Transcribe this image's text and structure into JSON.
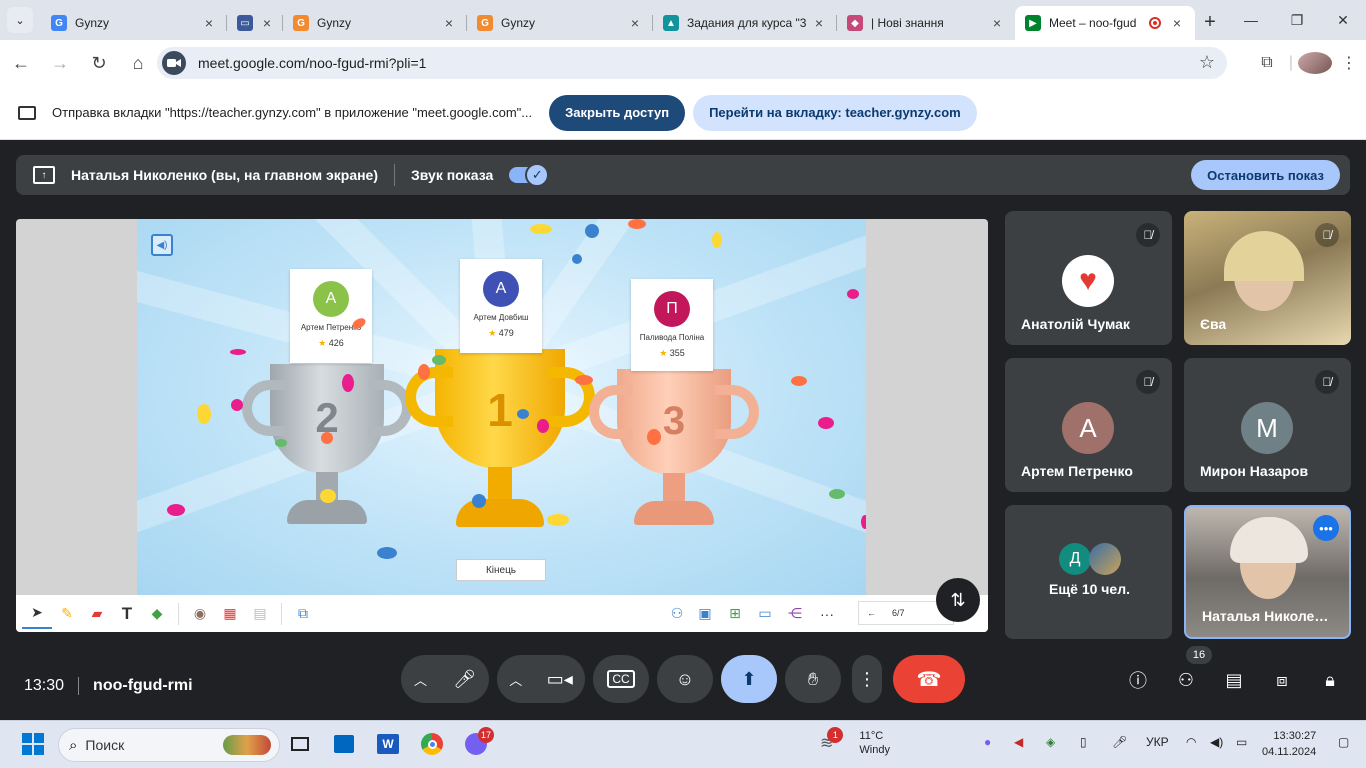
{
  "browser": {
    "tabs": [
      {
        "title": "Gynzy",
        "fav": "G",
        "color": "#4285f4"
      },
      {
        "title": "",
        "fav": "▭",
        "color": "#3c5a9a"
      },
      {
        "title": "Gynzy",
        "fav": "G",
        "color": "#f28b30"
      },
      {
        "title": "Gynzy",
        "fav": "G",
        "color": "#f28b30"
      },
      {
        "title": "Задания для курса \"3",
        "fav": "▲",
        "color": "#12949c"
      },
      {
        "title": "| Нові знання",
        "fav": "◆",
        "color": "#c44a7a"
      },
      {
        "title": "Meet – noo-fgud",
        "fav": "▶",
        "color": "#00832d"
      }
    ],
    "url": "meet.google.com/noo-fgud-rmi?pli=1"
  },
  "sharebar": {
    "message": "Отправка вкладки \"https://teacher.gynzy.com\" в приложение \"meet.google.com\"...",
    "stop_access": "Закрыть доступ",
    "goto_tab": "Перейти на вкладку: teacher.gynzy.com"
  },
  "presenting": {
    "name": "Наталья Николенко (вы, на главном экране)",
    "sound_label": "Звук показа",
    "stop_button": "Остановить показ"
  },
  "podium": [
    {
      "place": "2",
      "initial": "A",
      "name": "Артем Петренко",
      "score": "426",
      "color": "#8bc34a"
    },
    {
      "place": "1",
      "initial": "A",
      "name": "Артем Довбиш",
      "score": "479",
      "color": "#3f51b5"
    },
    {
      "place": "3",
      "initial": "П",
      "name": "Паливода Поліна",
      "score": "355",
      "color": "#c2185b"
    }
  ],
  "game": {
    "end_button": "Кінець",
    "pager": "6/7"
  },
  "participants": [
    {
      "name": "Анатолій Чумак",
      "type": "logo"
    },
    {
      "name": "Єва",
      "type": "video"
    },
    {
      "name": "Артем Петренко",
      "initial": "А",
      "color": "#a0706a"
    },
    {
      "name": "Мирон Назаров",
      "initial": "М",
      "color": "#6f8186"
    },
    {
      "name": "Ещё 10 чел.",
      "initial": "Д",
      "color": "#128c7e"
    },
    {
      "name": "Наталья Николен...",
      "type": "self"
    }
  ],
  "meeting": {
    "time": "13:30",
    "code": "noo-fgud-rmi",
    "people_count": "16"
  },
  "taskbar": {
    "search": "Поиск",
    "viber_badge": "17",
    "weather_badge": "1",
    "temp": "11°C",
    "weather": "Windy",
    "lang": "УКР",
    "clock_time": "13:30:27",
    "clock_date": "04.11.2024"
  }
}
